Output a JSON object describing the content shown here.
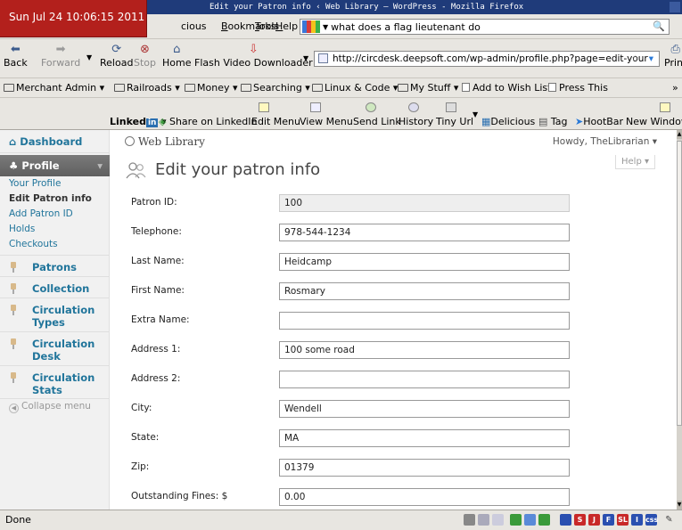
{
  "clock": "Sun Jul 24 10:06:15 2011",
  "window_title": "Edit your Patron info ‹ Web Library — WordPress - Mozilla Firefox",
  "menubar": {
    "items": [
      {
        "pre": "",
        "ul": "",
        "post": "cious"
      },
      {
        "pre": "",
        "ul": "B",
        "post": "ookmarks"
      },
      {
        "pre": "",
        "ul": "T",
        "post": "ools"
      },
      {
        "pre": "",
        "ul": "H",
        "post": "elp"
      }
    ],
    "search_text": "what does a flag lieutenant do"
  },
  "navbar": {
    "back": "Back",
    "forward": "Forward",
    "reload": "Reload",
    "stop": "Stop",
    "home": "Home",
    "flash": "Flash Video Downloader",
    "url": "http://circdesk.deepsoft.com/wp-admin/profile.php?page=edit-your",
    "print": "Print"
  },
  "bookmarks": [
    {
      "label": "Merchant Admin ▾",
      "icon": "folder"
    },
    {
      "label": "Railroads ▾",
      "icon": "folder"
    },
    {
      "label": "Money ▾",
      "icon": "folder"
    },
    {
      "label": "Searching ▾",
      "icon": "folder"
    },
    {
      "label": "Linux & Code ▾",
      "icon": "folder"
    },
    {
      "label": "My Stuff ▾",
      "icon": "folder"
    },
    {
      "label": "Add to Wish List",
      "icon": "page"
    },
    {
      "label": "Press This",
      "icon": "page"
    }
  ],
  "bookmarks_more": "»",
  "addonbar": {
    "linkedin_prefix": "Linked",
    "linkedin_badge": "in",
    "share": "Share on LinkedIn",
    "edit_menu": "Edit Menu",
    "view_menu": "View Menu",
    "send_link": "Send Link",
    "history": "History",
    "tiny_url": "Tiny Url",
    "delicious": "Delicious",
    "tag": "Tag",
    "hootbar": "HootBar",
    "new_window": "New Window"
  },
  "wp": {
    "site_title": "Web Library",
    "howdy": "Howdy, TheLibrarian ▾",
    "help": "Help ▾",
    "page_title": "Edit your patron info",
    "sidebar": {
      "dashboard": "Dashboard",
      "profile": "Profile",
      "profile_sub": [
        "Your Profile",
        "Edit Patron info",
        "Add Patron ID",
        "Holds",
        "Checkouts"
      ],
      "menus": [
        {
          "l1": "Patrons",
          "l2": ""
        },
        {
          "l1": "Collection",
          "l2": ""
        },
        {
          "l1": "Circulation",
          "l2": "Types"
        },
        {
          "l1": "Circulation",
          "l2": "Desk"
        },
        {
          "l1": "Circulation",
          "l2": "Stats"
        }
      ],
      "collapse": "Collapse menu"
    },
    "form": [
      {
        "label": "Patron ID:",
        "value": "100",
        "readonly": true
      },
      {
        "label": "Telephone:",
        "value": "978-544-1234"
      },
      {
        "label": "Last Name:",
        "value": "Heidcamp"
      },
      {
        "label": "First Name:",
        "value": "Rosmary"
      },
      {
        "label": "Extra Name:",
        "value": ""
      },
      {
        "label": "Address 1:",
        "value": "100 some road"
      },
      {
        "label": "Address 2:",
        "value": ""
      },
      {
        "label": "City:",
        "value": "Wendell"
      },
      {
        "label": "State:",
        "value": "MA"
      },
      {
        "label": "Zip:",
        "value": "01379"
      },
      {
        "label": "Outstanding Fines: $",
        "value": "0.00"
      }
    ]
  },
  "status": "Done",
  "status_icons": [
    {
      "name": "s-badge",
      "text": "S",
      "color": "#c82828"
    },
    {
      "name": "j-badge",
      "text": "J",
      "color": "#c82828"
    },
    {
      "name": "f-badge",
      "text": "F",
      "color": "#2a4fb0"
    },
    {
      "name": "sl-badge",
      "text": "SL",
      "color": "#c82828"
    },
    {
      "name": "info-badge",
      "text": "I",
      "color": "#2a4fb0"
    },
    {
      "name": "css-badge",
      "text": "css",
      "color": "#2a4fb0"
    }
  ]
}
